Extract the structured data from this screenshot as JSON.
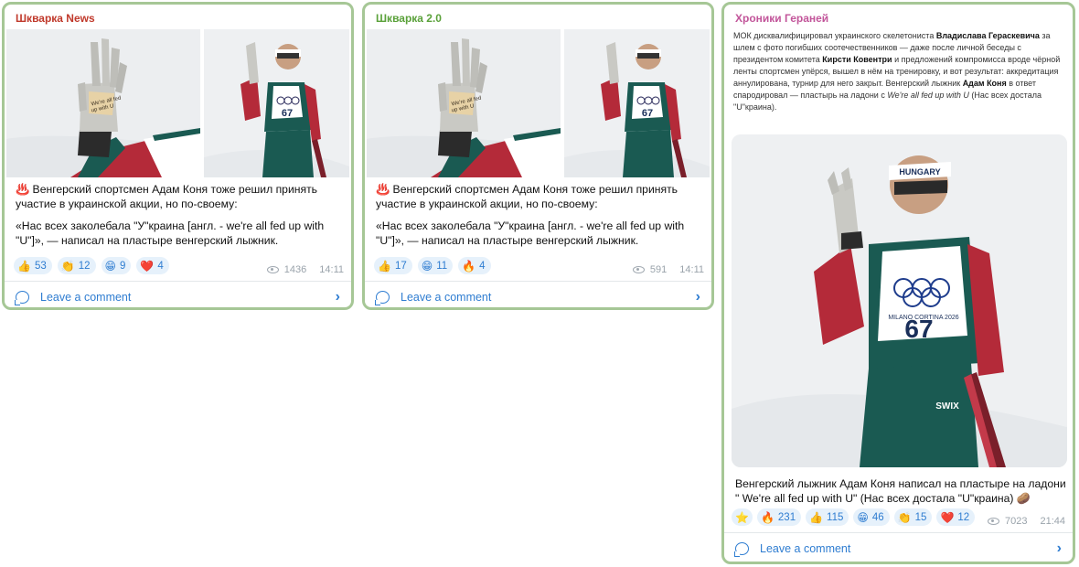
{
  "posts": [
    {
      "channel": "Шкварка News",
      "channel_color": "#c0392b",
      "text_line1": "♨️ Венгерский спортсмен Адам Коня тоже решил принять участие в украинской акции, но по-своему:",
      "text_line2": "«Нас всех заколебала \"У\"краина [англ. - we're all fed up with \"U\"]», — написал на пластыре венгерский лыжник.",
      "reactions": [
        {
          "icon": "thumbs-up-icon",
          "emoji": "👍",
          "count": "53"
        },
        {
          "icon": "clapping-hands-icon",
          "emoji": "👏",
          "count": "12"
        },
        {
          "icon": "grinning-face-icon",
          "emoji": "😁",
          "count": "9"
        },
        {
          "icon": "red-heart-icon",
          "emoji": "❤️",
          "count": "4"
        }
      ],
      "views": "1436",
      "time": "14:11",
      "comment_label": "Leave a comment"
    },
    {
      "channel": "Шкварка 2.0",
      "channel_color": "#5aa13a",
      "text_line1": "♨️ Венгерский спортсмен Адам Коня тоже решил принять участие в украинской акции, но по-своему:",
      "text_line2": "«Нас всех заколебала \"У\"краина [англ. - we're all fed up with \"U\"]», — написал на пластыре венгерский лыжник.",
      "reactions": [
        {
          "icon": "thumbs-up-icon",
          "emoji": "👍",
          "count": "17"
        },
        {
          "icon": "grinning-face-icon",
          "emoji": "😁",
          "count": "11"
        },
        {
          "icon": "fire-icon",
          "emoji": "🔥",
          "count": "4"
        }
      ],
      "views": "591",
      "time": "14:11",
      "comment_label": "Leave a comment"
    },
    {
      "channel": "Хроники Гераней",
      "channel_color": "#c2559a",
      "intro": {
        "p1": "МОК дисквалифицировал украинского скелетониста ",
        "b1": "Владислава Гераскевича",
        "p2": " за шлем с фото погибших соотечественников — даже после личной беседы с президентом комитета ",
        "b2": "Кирсти Ковентри",
        "p3": " и предложений компромисса вроде чёрной ленты спортсмен упёрся, вышел в нём на тренировку, и вот результат: аккредитация аннулирована, турнир для него закрыт. Венгерский лыжник ",
        "b3": "Адам Коня",
        "p4": " в ответ спародировал — пластырь на ладони с ",
        "i1": "We're all fed up with U",
        "p5": " (Нас всех достала \"U\"краина)."
      },
      "text": "Венгерский лыжник Адам Коня написал на пластыре на ладони \" We're all fed up with U\" (Нас всех достала \"U\"краина) 🥔",
      "reactions": [
        {
          "icon": "star-icon",
          "emoji": "⭐",
          "count": ""
        },
        {
          "icon": "fire-icon",
          "emoji": "🔥",
          "count": "231"
        },
        {
          "icon": "thumbs-up-icon",
          "emoji": "👍",
          "count": "115"
        },
        {
          "icon": "grinning-face-icon",
          "emoji": "😁",
          "count": "46"
        },
        {
          "icon": "clapping-hands-icon",
          "emoji": "👏",
          "count": "15"
        },
        {
          "icon": "red-heart-icon",
          "emoji": "❤️",
          "count": "12"
        }
      ],
      "views": "7023",
      "time": "21:44",
      "comment_label": "Leave a comment"
    }
  ],
  "photo_text": {
    "bib_number": "67",
    "headband": "HUNGARY",
    "event": "MILANO CORTINA 2026",
    "ski_brand": "SWIX"
  },
  "colors": {
    "border": "#a6c796",
    "link": "#2f7dd1",
    "reaction_bg": "#e6f1fb",
    "meta": "#9aa3ab"
  }
}
